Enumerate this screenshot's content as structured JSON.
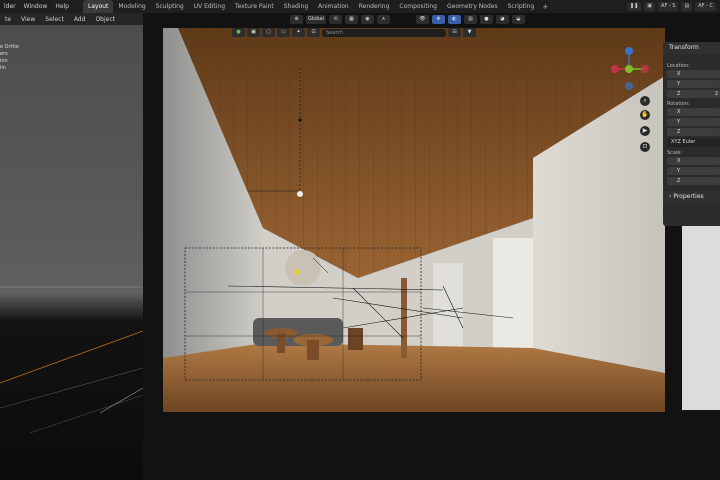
{
  "menu": {
    "items": [
      "lder",
      "Window",
      "Help"
    ]
  },
  "workspaces": {
    "tabs": [
      {
        "label": "Layout",
        "active": true
      },
      {
        "label": "Modeling"
      },
      {
        "label": "Sculpting"
      },
      {
        "label": "UV Editing"
      },
      {
        "label": "Texture Paint"
      },
      {
        "label": "Shading"
      },
      {
        "label": "Animation"
      },
      {
        "label": "Rendering"
      },
      {
        "label": "Compositing"
      },
      {
        "label": "Geometry Nodes"
      },
      {
        "label": "Scripting"
      }
    ],
    "add_label": "+"
  },
  "topright": {
    "scene1": "AF - S",
    "scene2": "AF - C"
  },
  "left_view": {
    "header_items": [
      "te",
      "View",
      "Select",
      "Add",
      "Object"
    ],
    "overlay_lines": [
      "e Ortho",
      "ers",
      "ion",
      "lin"
    ]
  },
  "main_header": {
    "orientation": "Global"
  },
  "sub_header": {
    "search_placeholder": "Search"
  },
  "npanel": {
    "title": "Transform",
    "location_label": "Location:",
    "location": [
      {
        "axis": "X",
        "value": ""
      },
      {
        "axis": "Y",
        "value": ""
      },
      {
        "axis": "Z",
        "value": "2"
      }
    ],
    "rotation_label": "Rotation:",
    "rotation": [
      {
        "axis": "X"
      },
      {
        "axis": "Y"
      },
      {
        "axis": "Z"
      }
    ],
    "rotation_mode": "XYZ Euler",
    "scale_label": "Scale:",
    "scale": [
      {
        "axis": "X"
      },
      {
        "axis": "Y"
      },
      {
        "axis": "Z"
      }
    ],
    "properties_label": "Properties"
  },
  "gizmo": {
    "x_color": "#c9334a",
    "y_color": "#7fbf2a",
    "z_color": "#3a74c9"
  }
}
